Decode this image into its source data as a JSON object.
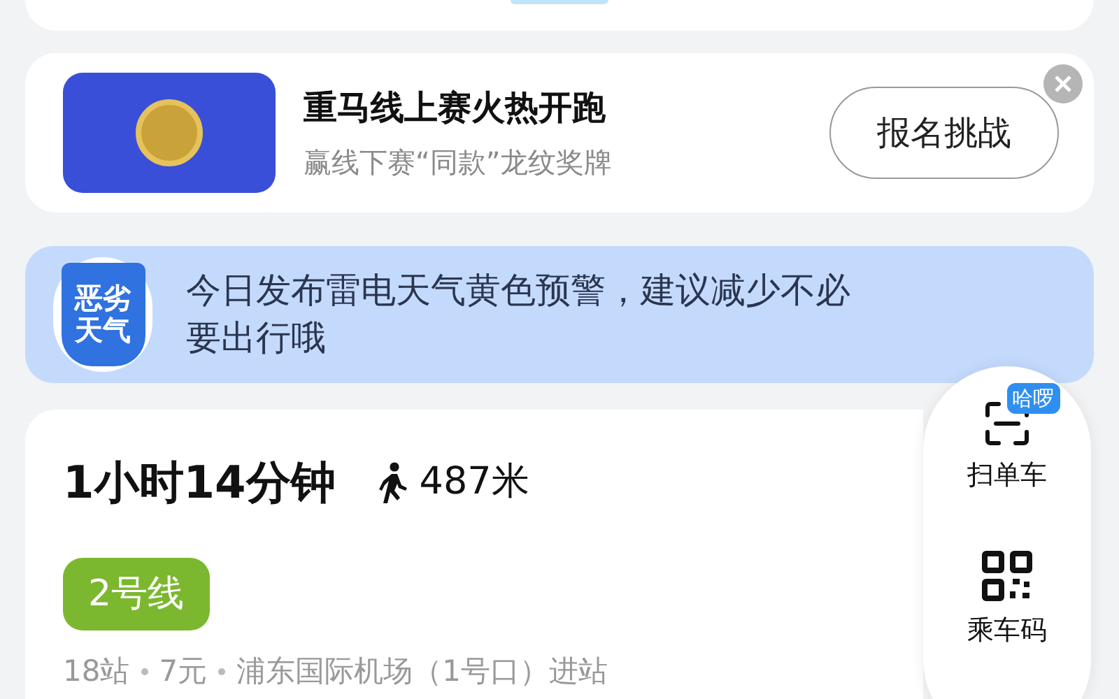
{
  "promo": {
    "title": "重马线上赛火热开跑",
    "subtitle": "赢线下赛“同款”龙纹奖牌",
    "button": "报名挑战"
  },
  "weather_alert": {
    "badge_line_1": "恶劣",
    "badge_line_2": "天气",
    "message": "今日发布雷电天气黄色预警，建议减少不必要出行哦"
  },
  "route": {
    "duration": "1小时14分钟",
    "walk_distance": "487米",
    "line": {
      "name": "2号线",
      "color": "#7cb82f"
    },
    "details": [
      "18站",
      "7元",
      "浦东国际机场（1号口）进站"
    ]
  },
  "quick_actions": [
    {
      "kind": "scan",
      "label": "扫单车",
      "badge": "哈啰"
    },
    {
      "kind": "qr",
      "label": "乘车码"
    }
  ]
}
